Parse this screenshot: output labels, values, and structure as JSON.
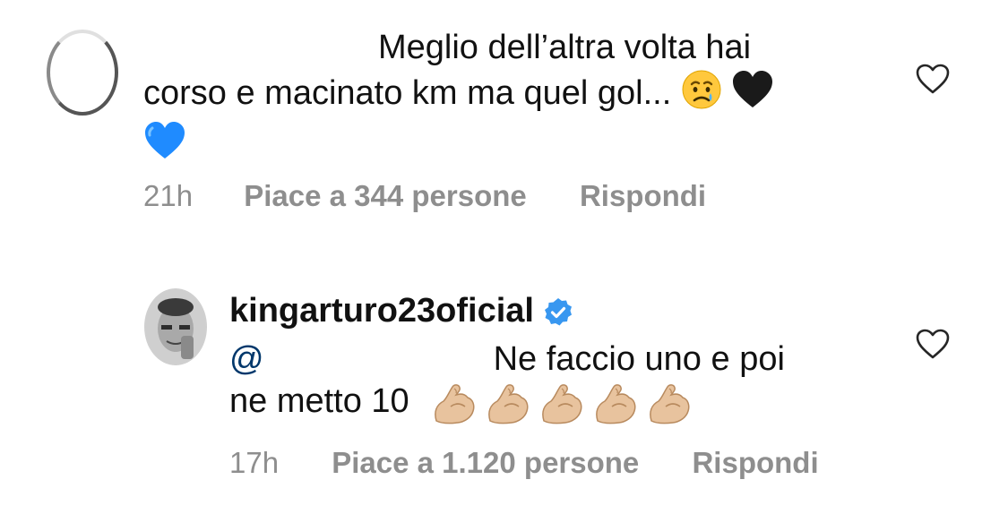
{
  "comments": [
    {
      "text_line1": "Meglio dell’altra volta hai",
      "text_line2": "corso e macinato km ma quel gol...",
      "emojis": [
        "😢",
        "🖤",
        "💙"
      ],
      "time": "21h",
      "likes": "Piace a 344 persone",
      "reply": "Rispondi"
    },
    {
      "username": "kingarturo23oficial",
      "verified": true,
      "mention": "@",
      "text_line1": "Ne faccio uno e poi",
      "text_line2": "ne metto 10",
      "emojis": [
        "💪🏼",
        "💪🏼",
        "💪🏼",
        "💪🏼",
        "💪🏼"
      ],
      "time": "17h",
      "likes": "Piace a 1.120 persone",
      "reply": "Rispondi"
    }
  ],
  "colors": {
    "meta_gray": "#8e8e8e",
    "verified_blue": "#3897f0",
    "mention_blue": "#00376b"
  }
}
